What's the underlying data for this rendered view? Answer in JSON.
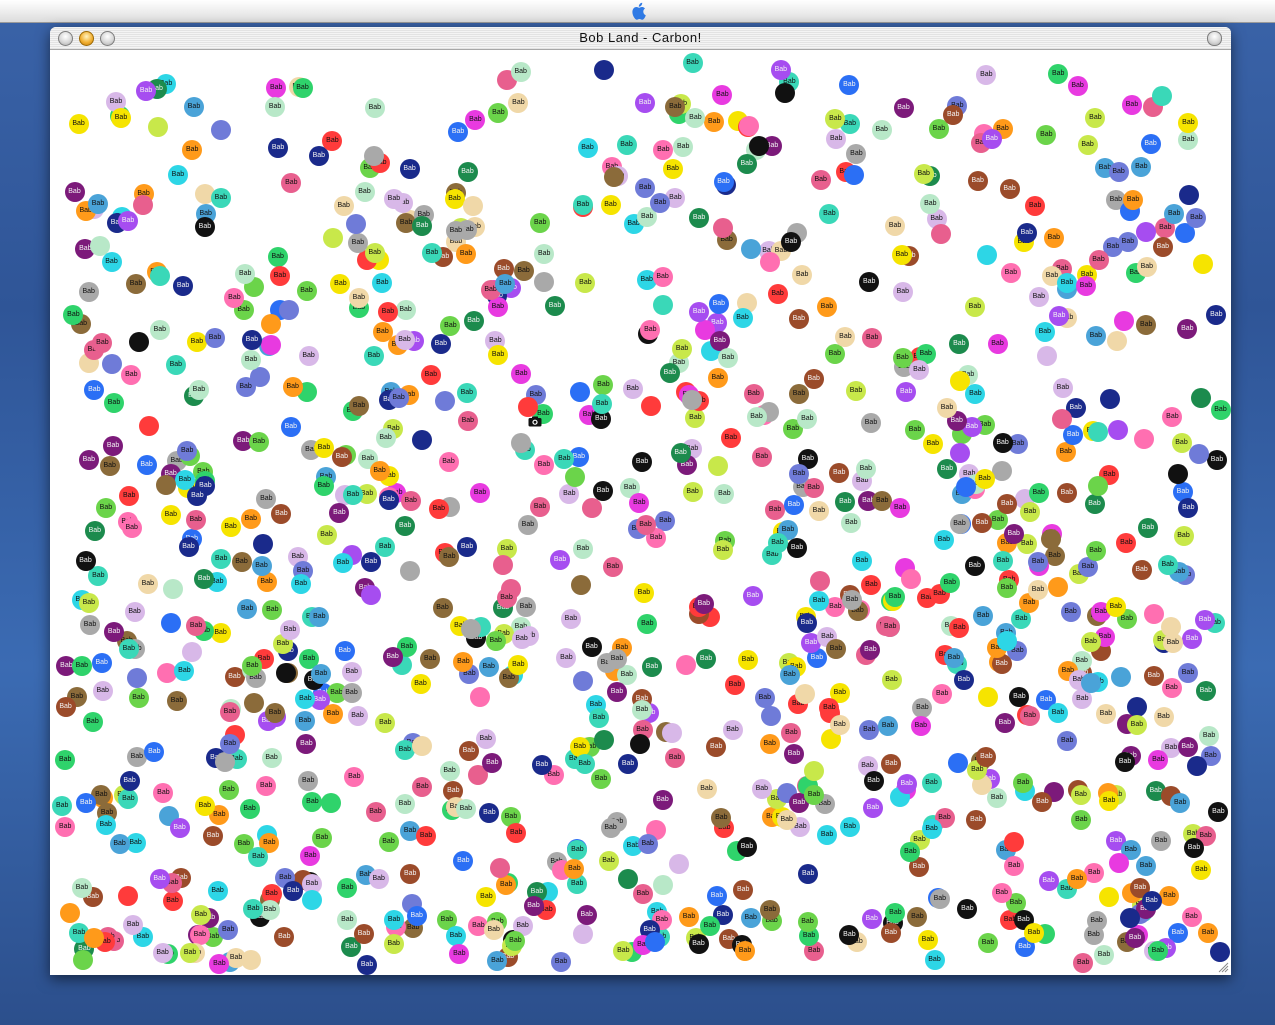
{
  "desktop": {
    "menubar_icon": "apple-logo-icon"
  },
  "window": {
    "title": "Bob Land - Carbon!",
    "buttons": [
      "close",
      "minimize",
      "zoom"
    ],
    "toolbar_button": "toolbar-toggle"
  },
  "bobs": {
    "label": "Bab",
    "count": 1100,
    "palette": [
      "#ff3b3b",
      "#2fd36b",
      "#f6e400",
      "#2b6ff5",
      "#a64df0",
      "#ff6fb1",
      "#2dd6e6",
      "#ff9a1a",
      "#6bd44a",
      "#9b4b2a",
      "#a9a9a9",
      "#6f7bd8",
      "#e85f8e",
      "#1c8b4d",
      "#7c1a7a",
      "#1a2a8b",
      "#d8b8e8",
      "#b8e8c8",
      "#f0d8a8",
      "#111111",
      "#4aa3d8",
      "#c8e84a",
      "#8b6b3a",
      "#3ad8b8",
      "#e83ae0"
    ]
  },
  "cursor": {
    "icon": "camera-icon"
  }
}
